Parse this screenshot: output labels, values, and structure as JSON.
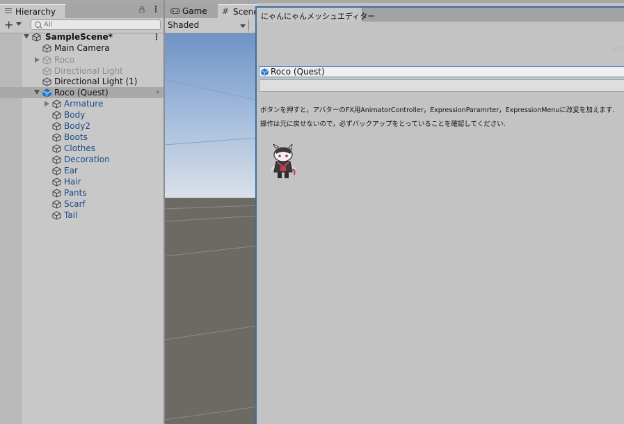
{
  "hierarchy": {
    "tab_label": "Hierarchy",
    "search_placeholder": "All",
    "items": [
      {
        "label": "SampleScene*"
      },
      {
        "label": "Main Camera"
      },
      {
        "label": "Roco"
      },
      {
        "label": "Directional Light"
      },
      {
        "label": "Directional Light (1)"
      },
      {
        "label": "Roco (Quest)"
      },
      {
        "label": "Armature"
      },
      {
        "label": "Body"
      },
      {
        "label": "Body2"
      },
      {
        "label": "Boots"
      },
      {
        "label": "Clothes"
      },
      {
        "label": "Decoration"
      },
      {
        "label": "Ear"
      },
      {
        "label": "Hair"
      },
      {
        "label": "Pants"
      },
      {
        "label": "Scarf"
      },
      {
        "label": "Tail"
      }
    ]
  },
  "scene": {
    "game_tab_label": "Game",
    "scene_tab_label": "Scene",
    "shading_mode": "Shaded"
  },
  "editor": {
    "tab_label": "にゃんにゃんメッシュエディター",
    "object_field_value": "Roco (Quest)",
    "description_line1": "ボタンを押すと，アバターのFX用AnimatorController，ExpressionParamrter，ExpressionMenuに改変を加えます.",
    "description_line2": "操作は元に戻せないので，必ずバックアップをとっていることを確認してください.",
    "faint_text": "Unit"
  },
  "colors": {
    "selected_blue": "#1a4a8a",
    "accent": "#3a6ea5"
  }
}
